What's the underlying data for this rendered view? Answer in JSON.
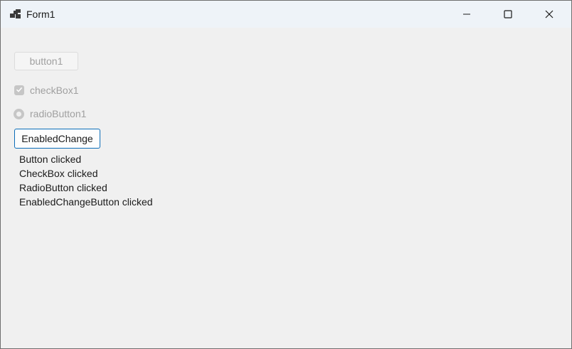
{
  "window": {
    "title": "Form1",
    "icons": {
      "app": "form-app-icon",
      "minimize": "minimize-icon",
      "maximize": "maximize-icon",
      "close": "close-icon"
    }
  },
  "controls": {
    "button1": {
      "label": "button1",
      "enabled": false
    },
    "checkbox1": {
      "label": "checkBox1",
      "checked": true,
      "enabled": false
    },
    "radiobutton1": {
      "label": "radioButton1",
      "selected": true,
      "enabled": false
    },
    "enabled_change_button": {
      "label": "EnabledChange",
      "enabled": true
    }
  },
  "log": {
    "lines": [
      "Button clicked",
      "CheckBox clicked",
      "RadioButton clicked",
      "EnabledChangeButton clicked"
    ]
  },
  "colors": {
    "client_background": "#f0f0f0",
    "titlebar_background": "#eef3f8",
    "disabled_text": "#a0a0a0",
    "focus_border": "#0a6cb8"
  }
}
